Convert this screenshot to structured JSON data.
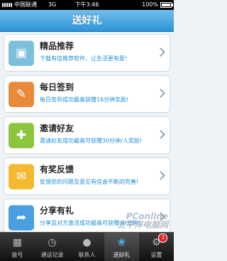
{
  "status_bar": {
    "carrier": "中国联通",
    "network": "3G",
    "time": "下午3:46",
    "battery_percent": "100%",
    "battery_level": 1.0
  },
  "header": {
    "title": "送好礼"
  },
  "items": [
    {
      "title": "精品推荐",
      "description": "下载有信推荐软件，让生活更有爱！",
      "icon": "gift-box-icon",
      "color": "#7cc0dc"
    },
    {
      "title": "每日签到",
      "description": "每日签到成功最高获赠16分钟奖励!",
      "icon": "notebook-pen-icon",
      "color": "#e98a3a"
    },
    {
      "title": "邀请好友",
      "description": "邀请好友成功最高可获赠30分钟/人奖励!",
      "icon": "add-friend-icon",
      "color": "#8cc63e"
    },
    {
      "title": "有奖反馈",
      "description": "反馈您的问题及意见有信会不断的完善!",
      "icon": "feedback-bubble-icon",
      "color": "#f5b931"
    },
    {
      "title": "分享有礼",
      "description": "分享且对方激活成功最高可获赠30分钟/...",
      "icon": "share-icon",
      "color": "#4a9fe0"
    }
  ],
  "tabs": [
    {
      "label": "拨号",
      "icon": "keypad-icon"
    },
    {
      "label": "通话记录",
      "icon": "clock-icon"
    },
    {
      "label": "联系人",
      "icon": "contact-icon"
    },
    {
      "label": "送好礼",
      "icon": "gift-icon",
      "active": true
    },
    {
      "label": "设置",
      "icon": "gear-icon",
      "badge": "2"
    }
  ],
  "watermark": {
    "line1": "PConline",
    "line2": "太平洋电脑网"
  }
}
